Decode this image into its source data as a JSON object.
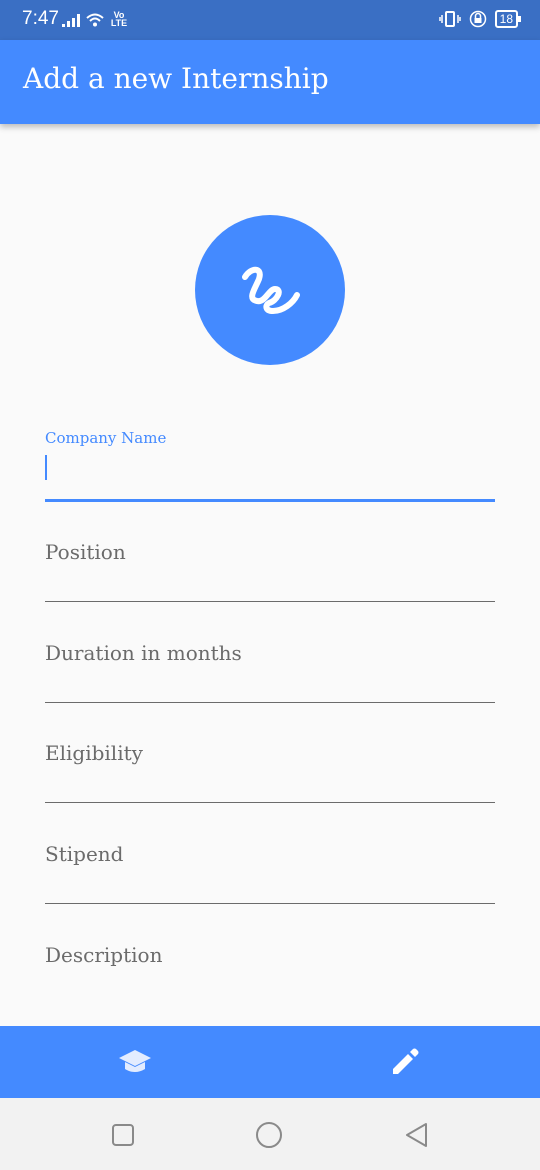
{
  "status_bar": {
    "time": "7:47",
    "network": "Vo LTE",
    "battery": "18"
  },
  "app_bar": {
    "title": "Add a new Internship"
  },
  "logo": {
    "icon": "squiggle-logo-icon",
    "color": "#448aff"
  },
  "form": {
    "company_name": {
      "label": "Company Name",
      "value": ""
    },
    "position": {
      "label": "Position",
      "value": ""
    },
    "duration": {
      "label": "Duration in months",
      "value": ""
    },
    "eligibility": {
      "label": "Eligibility",
      "value": ""
    },
    "stipend": {
      "label": "Stipend",
      "value": ""
    },
    "description": {
      "label": "Description",
      "value": ""
    }
  },
  "bottom_nav": {
    "items": [
      {
        "icon": "graduation-cap-icon",
        "active": false
      },
      {
        "icon": "pencil-icon",
        "active": true
      }
    ]
  },
  "system_nav": {
    "items": [
      "recents-square-icon",
      "home-circle-icon",
      "back-triangle-icon"
    ]
  },
  "colors": {
    "primary": "#448aff",
    "status_bar": "#3a6fc4",
    "background": "#fafafa"
  }
}
